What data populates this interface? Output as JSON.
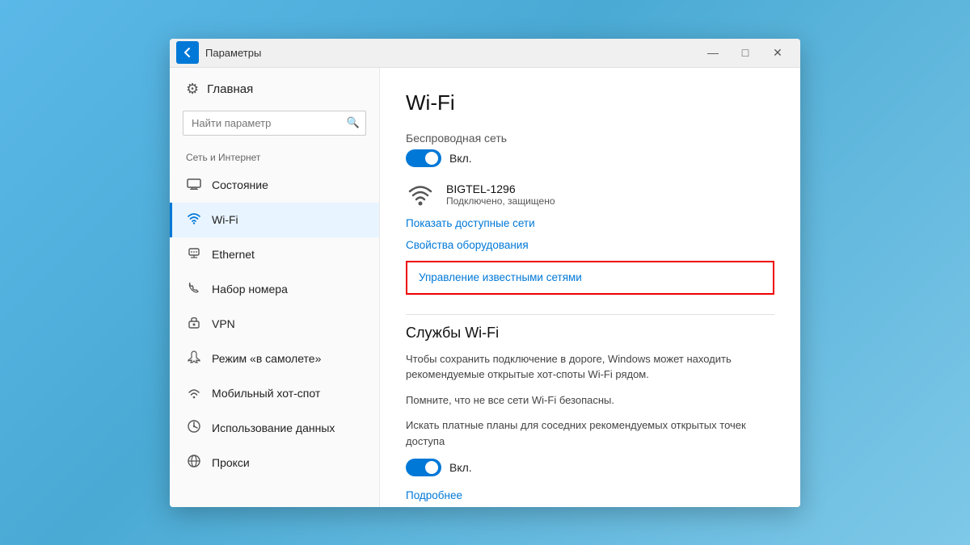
{
  "window": {
    "title": "Параметры",
    "controls": {
      "minimize": "—",
      "maximize": "□",
      "close": "✕"
    }
  },
  "sidebar": {
    "back_icon": "←",
    "home_icon": "⚙",
    "home_label": "Главная",
    "search_placeholder": "Найти параметр",
    "search_icon": "🔍",
    "section_label": "Сеть и Интернет",
    "items": [
      {
        "id": "status",
        "icon": "🖥",
        "label": "Состояние"
      },
      {
        "id": "wifi",
        "icon": "📶",
        "label": "Wi-Fi",
        "active": true
      },
      {
        "id": "ethernet",
        "icon": "🖧",
        "label": "Ethernet"
      },
      {
        "id": "dialup",
        "icon": "📞",
        "label": "Набор номера"
      },
      {
        "id": "vpn",
        "icon": "🔒",
        "label": "VPN"
      },
      {
        "id": "airplane",
        "icon": "✈",
        "label": "Режим «в самолете»"
      },
      {
        "id": "hotspot",
        "icon": "📡",
        "label": "Мобильный хот-спот"
      },
      {
        "id": "datausage",
        "icon": "📊",
        "label": "Использование данных"
      },
      {
        "id": "proxy",
        "icon": "🌐",
        "label": "Прокси"
      }
    ]
  },
  "content": {
    "title": "Wi-Fi",
    "wireless_network_label": "Беспроводная сеть",
    "toggle_label": "Вкл.",
    "network_name": "BIGTEL-1296",
    "network_status": "Подключено, защищено",
    "show_networks_link": "Показать доступные сети",
    "hardware_props_link": "Свойства оборудования",
    "manage_networks_link": "Управление известными сетями",
    "wifi_services_title": "Службы Wi-Fi",
    "wifi_services_text1": "Чтобы сохранить подключение в дороге, Windows может находить рекомендуемые открытые хот-споты Wi-Fi рядом.",
    "wifi_services_text2": "Помните, что не все сети Wi-Fi безопасны.",
    "paid_plans_text": "Искать платные планы для соседних рекомендуемых открытых точек доступа",
    "paid_toggle_label": "Вкл.",
    "more_link": "Подробнее"
  }
}
